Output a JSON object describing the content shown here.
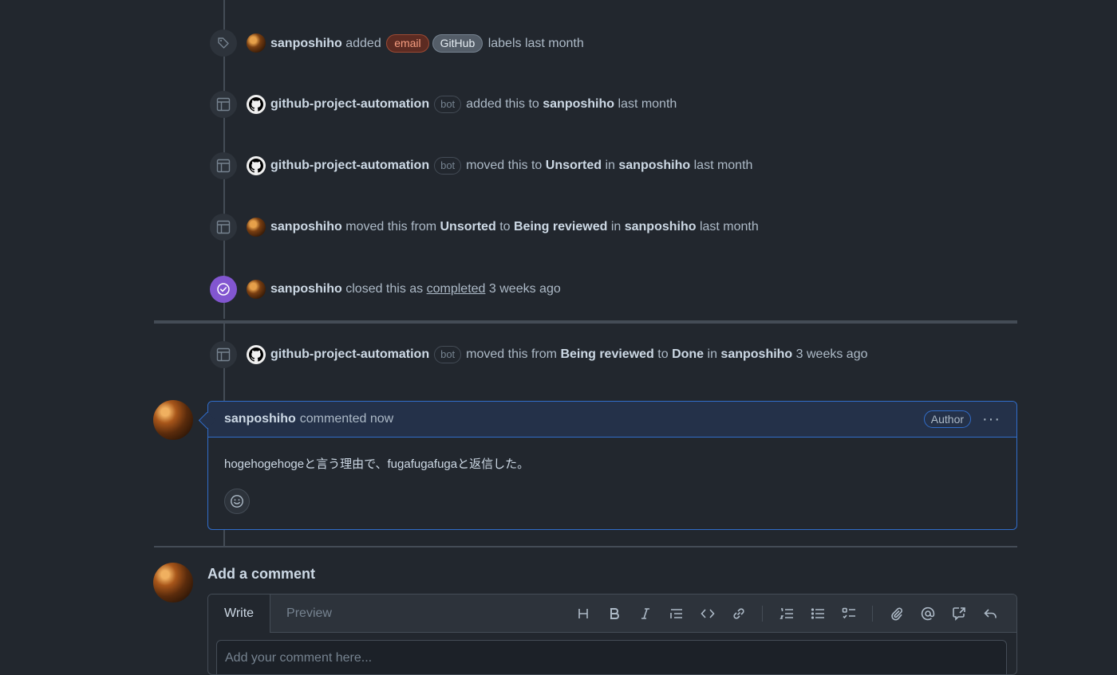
{
  "timeline": {
    "label_event": {
      "actor": "sanposhiho",
      "verb": "added",
      "labels": [
        "email",
        "GitHub"
      ],
      "suffix": "labels",
      "time": "last month"
    },
    "project_add": {
      "actor": "github-project-automation",
      "bot_tag": "bot",
      "text": "added this to",
      "project": "sanposhiho",
      "time": "last month"
    },
    "project_move1": {
      "actor": "github-project-automation",
      "bot_tag": "bot",
      "text": "moved this to",
      "column": "Unsorted",
      "in": "in",
      "project": "sanposhiho",
      "time": "last month"
    },
    "project_move2": {
      "actor": "sanposhiho",
      "text": "moved this from",
      "from": "Unsorted",
      "to_word": "to",
      "to": "Being reviewed",
      "in": "in",
      "project": "sanposhiho",
      "time": "last month"
    },
    "closed": {
      "actor": "sanposhiho",
      "text": "closed this as",
      "state": "completed",
      "time": "3 weeks ago"
    },
    "project_move3": {
      "actor": "github-project-automation",
      "bot_tag": "bot",
      "text": "moved this from",
      "from": "Being reviewed",
      "to_word": "to",
      "to": "Done",
      "in": "in",
      "project": "sanposhiho",
      "time": "3 weeks ago"
    }
  },
  "comment": {
    "author": "sanposhiho",
    "meta": "commented now",
    "author_badge": "Author",
    "menu": "···",
    "body": "hogehogehogeと言う理由で、fugafugafugaと返信した。"
  },
  "add_comment": {
    "title": "Add a comment",
    "tabs": [
      "Write",
      "Preview"
    ],
    "placeholder": "Add your comment here..."
  },
  "colors": {
    "background": "#22272e",
    "accent_blue": "#316dca",
    "closed_purple": "#8256d0",
    "label_email": "#f69d80",
    "label_github": "#545d68"
  },
  "icons": [
    "tag-icon",
    "table-icon",
    "check-circle-icon",
    "github-mark-icon",
    "smiley-icon",
    "heading-icon",
    "bold-icon",
    "italic-icon",
    "quote-icon",
    "code-icon",
    "link-icon",
    "numbered-list-icon",
    "bullet-list-icon",
    "task-list-icon",
    "attach-icon",
    "mention-icon",
    "cross-reference-icon",
    "reply-icon"
  ]
}
